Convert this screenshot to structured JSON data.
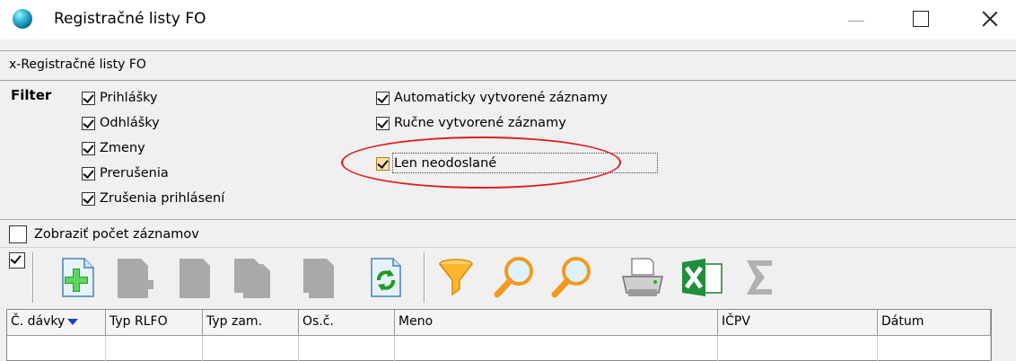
{
  "window": {
    "title": "Registračné listy FO"
  },
  "panel": {
    "header": "x-Registračné listy FO"
  },
  "filter": {
    "label": "Filter",
    "left_options": [
      {
        "label": "Prihlášky",
        "checked": true
      },
      {
        "label": "Odhlášky",
        "checked": true
      },
      {
        "label": "Zmeny",
        "checked": true
      },
      {
        "label": "Prerušenia",
        "checked": true
      },
      {
        "label": "Zrušenia prihlásení",
        "checked": true
      }
    ],
    "right_options": [
      {
        "label": "Automaticky vytvorené záznamy",
        "checked": true
      },
      {
        "label": "Ručne vytvorené záznamy",
        "checked": true
      },
      {
        "label": "Len neodoslané",
        "checked": true,
        "highlighted": true
      }
    ],
    "highlight_color": "#e01b1b"
  },
  "count": {
    "label": "Zobraziť počet záznamov",
    "checked": false
  },
  "toolbar": {
    "select_all_checked": true,
    "buttons": [
      {
        "icon": "add-icon",
        "enabled": true
      },
      {
        "icon": "document-edit-icon",
        "enabled": false
      },
      {
        "icon": "document-icon",
        "enabled": false
      },
      {
        "icon": "documents-icon",
        "enabled": false
      },
      {
        "icon": "document-delete-icon",
        "enabled": false
      },
      {
        "icon": "refresh-icon",
        "enabled": true
      },
      {
        "icon": "filter-funnel-icon",
        "enabled": true
      },
      {
        "icon": "search-icon",
        "enabled": true
      },
      {
        "icon": "search-next-icon",
        "enabled": true
      },
      {
        "icon": "printer-icon",
        "enabled": true
      },
      {
        "icon": "excel-export-icon",
        "enabled": true
      },
      {
        "icon": "sum-icon",
        "enabled": false
      }
    ]
  },
  "grid": {
    "columns": [
      "Č. dávky",
      "Typ RLFO",
      "Typ zam.",
      "Os.č.",
      "Meno",
      "IČPV",
      "Dátum"
    ],
    "sort_column": "Č. dávky",
    "rows": []
  }
}
